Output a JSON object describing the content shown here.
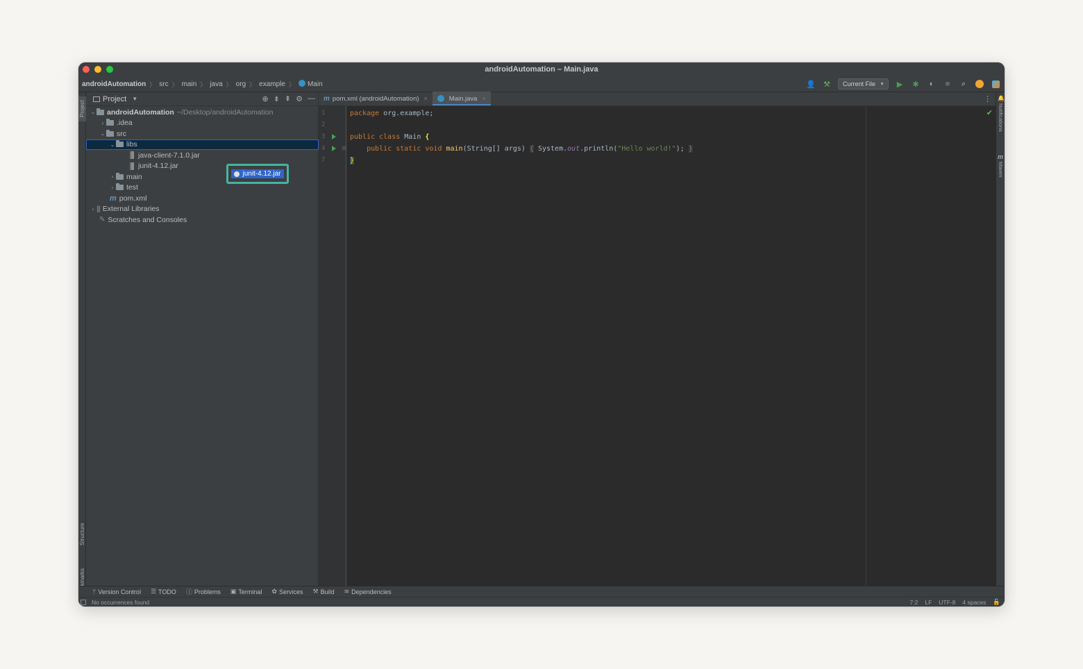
{
  "window": {
    "title": "androidAutomation – Main.java"
  },
  "breadcrumbs": [
    "androidAutomation",
    "src",
    "main",
    "java",
    "org",
    "example",
    "Main"
  ],
  "toolbar": {
    "run_config": "Current File"
  },
  "project_panel": {
    "title": "Project",
    "tree": [
      {
        "label": "androidAutomation",
        "hint": "~/Desktop/androidAutomation",
        "type": "module"
      },
      {
        "label": ".idea",
        "type": "folder"
      },
      {
        "label": "src",
        "type": "folder"
      },
      {
        "label": "libs",
        "type": "folder"
      },
      {
        "label": "java-client-7.1.0.jar",
        "type": "jar"
      },
      {
        "label": "junit-4.12.jar",
        "type": "jar"
      },
      {
        "label": "main",
        "type": "folder"
      },
      {
        "label": "test",
        "type": "folder"
      },
      {
        "label": "pom.xml",
        "type": "maven"
      },
      {
        "label": "External Libraries",
        "type": "libraries"
      },
      {
        "label": "Scratches and Consoles",
        "type": "scratches"
      }
    ],
    "drag_tooltip": "junit-4.12.jar"
  },
  "editor": {
    "tabs": [
      {
        "label": "pom.xml (androidAutomation)",
        "active": false
      },
      {
        "label": "Main.java",
        "active": true
      }
    ],
    "line_numbers": [
      "1",
      "2",
      "3",
      "4",
      "7"
    ],
    "code": {
      "l1_kw": "package",
      "l1_rest": " org.example;",
      "l3_kw": "public class",
      "l3_name": " Main ",
      "l3_brace": "{",
      "l4_kw": "public static void",
      "l4_fn": "main",
      "l4_args": "(String[] args) ",
      "l4_open": "{",
      "l4_sys": " System.",
      "l4_out": "out",
      "l4_call": ".println(",
      "l4_str": "\"Hello world!\"",
      "l4_end": "); ",
      "l4_close": "}",
      "l7_brace": "}"
    }
  },
  "right_strip": {
    "notifications": "Notifications",
    "maven": "Maven"
  },
  "left_strip": {
    "project": "Project",
    "structure": "Structure",
    "bookmarks": "Bookmarks"
  },
  "bottom_tools": [
    "Version Control",
    "TODO",
    "Problems",
    "Terminal",
    "Services",
    "Build",
    "Dependencies"
  ],
  "status": {
    "message": "No occurrences found",
    "position": "7:2",
    "line_sep": "LF",
    "encoding": "UTF-8",
    "indent": "4 spaces"
  },
  "colors": {
    "accent": "#2f65ca",
    "drag_highlight": "#44b5a2",
    "run_green": "#499c54"
  }
}
